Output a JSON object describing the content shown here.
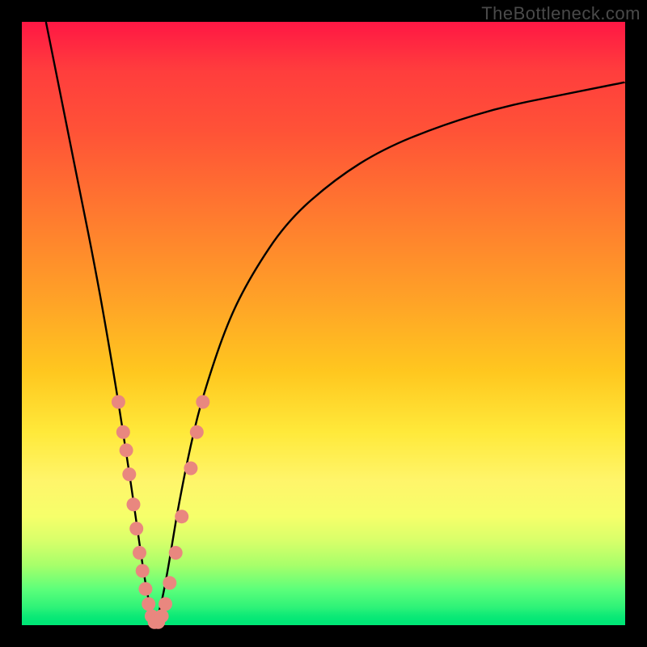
{
  "watermark": "TheBottleneck.com",
  "colors": {
    "frame": "#000000",
    "curve": "#000000",
    "marker_fill": "#e9877f",
    "marker_stroke": "#e9877f",
    "gradient_top": "#ff1744",
    "gradient_bottom": "#00e676"
  },
  "chart_data": {
    "type": "line",
    "title": "",
    "xlabel": "",
    "ylabel": "",
    "xlim": [
      0,
      100
    ],
    "ylim": [
      0,
      100
    ],
    "curve": {
      "name": "bottleneck-curve",
      "description": "V-shaped bottleneck curve: steep left branch drops from top-left to a minimum near x≈22, then a gentler right branch rises toward upper right.",
      "x": [
        4,
        6,
        8,
        10,
        12,
        14,
        16,
        18,
        19,
        20,
        21,
        22,
        23,
        24,
        25,
        26,
        28,
        30,
        34,
        38,
        44,
        52,
        60,
        70,
        80,
        90,
        100
      ],
      "y": [
        100,
        90,
        80,
        70,
        60,
        49,
        37,
        24,
        17,
        10,
        4,
        0,
        3,
        8,
        14,
        20,
        30,
        38,
        50,
        58,
        67,
        74,
        79,
        83,
        86,
        88,
        90
      ]
    },
    "markers": {
      "name": "highlighted-points",
      "description": "Salmon circular markers clustered along the lower portion of both branches.",
      "points": [
        {
          "x": 16.0,
          "y": 37
        },
        {
          "x": 16.8,
          "y": 32
        },
        {
          "x": 17.3,
          "y": 29
        },
        {
          "x": 17.8,
          "y": 25
        },
        {
          "x": 18.5,
          "y": 20
        },
        {
          "x": 19.0,
          "y": 16
        },
        {
          "x": 19.5,
          "y": 12
        },
        {
          "x": 20.0,
          "y": 9
        },
        {
          "x": 20.5,
          "y": 6
        },
        {
          "x": 21.0,
          "y": 3.5
        },
        {
          "x": 21.5,
          "y": 1.5
        },
        {
          "x": 22.0,
          "y": 0.5
        },
        {
          "x": 22.6,
          "y": 0.5
        },
        {
          "x": 23.2,
          "y": 1.5
        },
        {
          "x": 23.8,
          "y": 3.5
        },
        {
          "x": 24.5,
          "y": 7
        },
        {
          "x": 25.5,
          "y": 12
        },
        {
          "x": 26.5,
          "y": 18
        },
        {
          "x": 28.0,
          "y": 26
        },
        {
          "x": 29.0,
          "y": 32
        },
        {
          "x": 30.0,
          "y": 37
        }
      ]
    }
  }
}
